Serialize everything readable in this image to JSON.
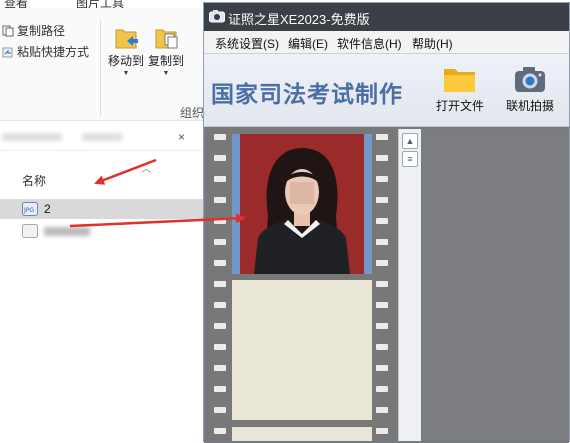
{
  "explorer": {
    "ribbon_tabs": [
      "查看",
      "图片工具"
    ],
    "copy_path": "复制路径",
    "paste_shortcut": "粘贴快捷方式",
    "move_to": "移动到",
    "copy_to": "复制到",
    "group_label": "组织",
    "close_x": "×",
    "column_name": "名称",
    "files": [
      {
        "name": "2",
        "icon": "jpg-file-icon",
        "selected": true
      },
      {
        "name": "",
        "icon": "file-icon",
        "selected": false
      }
    ]
  },
  "app": {
    "title": "证照之星XE2023-免费版",
    "menu": [
      "系统设置(S)",
      "编辑(E)",
      "软件信息(H)",
      "帮助(H)"
    ],
    "brand": "国家司法考试制作",
    "toolbar": {
      "open_file": "打开文件",
      "tethered_capture": "联机拍摄"
    },
    "scroll_icons": [
      "chevron-up-icon",
      "page-icon"
    ]
  },
  "colors": {
    "titlebar": "#3b3f46",
    "brand_text": "#4a6fa5",
    "photo_background": "#9b2a2a",
    "arrow": "#e0312c",
    "film": "#787878",
    "frame_blank": "#e9e6d8"
  }
}
